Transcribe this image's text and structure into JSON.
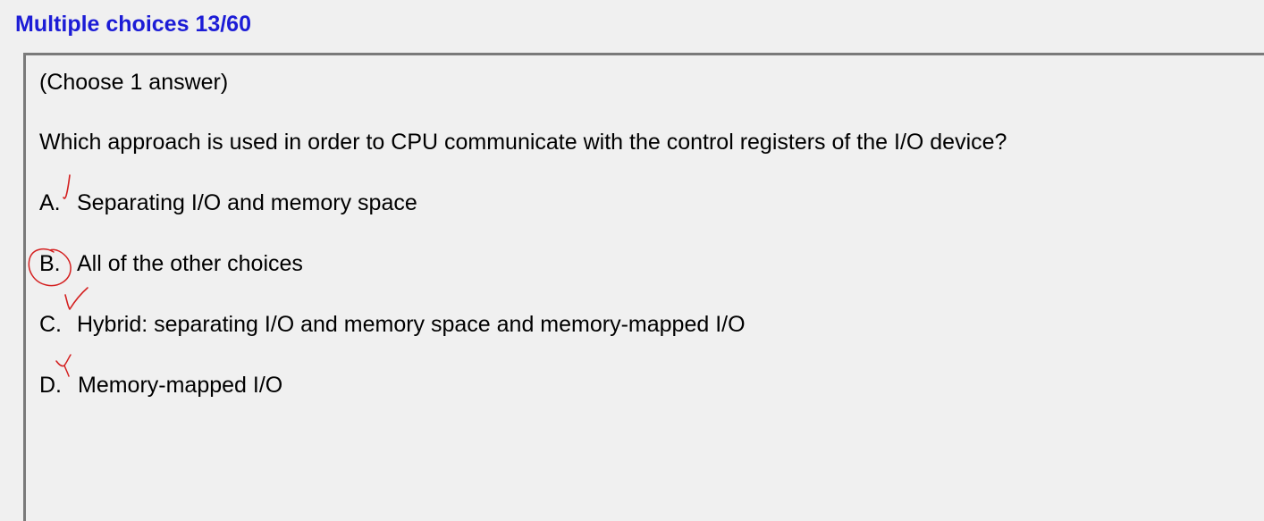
{
  "header": {
    "title": "Multiple choices 13/60"
  },
  "question": {
    "instruction": "(Choose 1 answer)",
    "text": "Which approach is used in order to CPU communicate with the control registers of the I/O device?",
    "options": [
      {
        "letter": "A.",
        "text": "Separating I/O and memory space"
      },
      {
        "letter": "B.",
        "text": "All of the other choices"
      },
      {
        "letter": "C.",
        "text": "Hybrid: separating I/O and memory space and memory-mapped I/O"
      },
      {
        "letter": "D.",
        "text": "Memory-mapped I/O"
      }
    ]
  },
  "annotations": {
    "ink_color": "#d42020",
    "circled_option": "B.",
    "checked_options": [
      "A.",
      "C.",
      "D."
    ],
    "mark_icons": [
      "check-mark-icon",
      "circle-mark-icon"
    ]
  },
  "colors": {
    "title": "#1c1cd6",
    "background": "#f0f0f0",
    "panel_border": "#7a7a7a",
    "text": "#000000"
  }
}
